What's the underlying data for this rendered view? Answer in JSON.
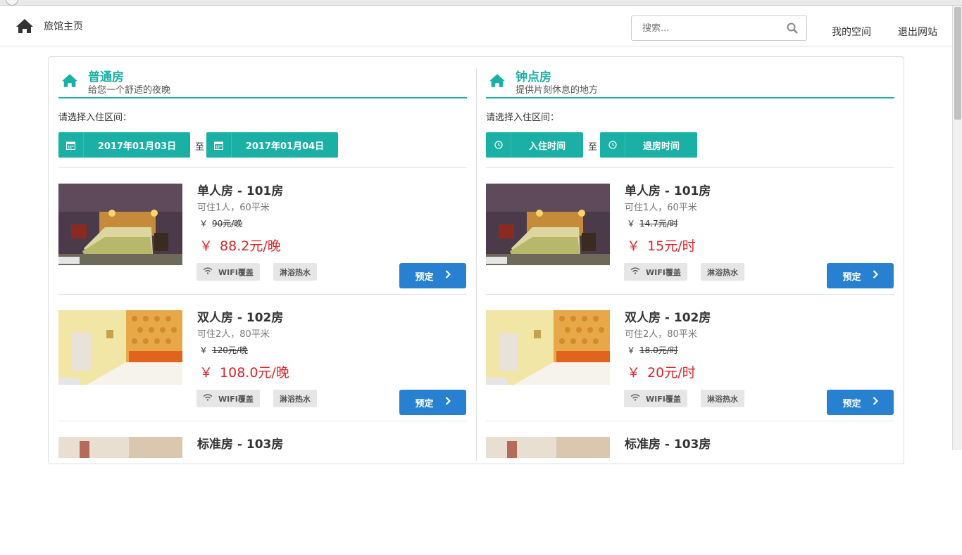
{
  "nav": {
    "home_icon": "home-icon",
    "title": "旅馆主页",
    "search_placeholder": "搜索...",
    "search_icon": "search-icon",
    "my_space": "我的空间",
    "logout": "退出网站"
  },
  "sections": [
    {
      "title": "普通房",
      "subtitle": "给您一个舒适的夜晚",
      "pick_label": "请选择入住区间：",
      "start": "2017年01月03日",
      "to": "至",
      "end": "2017年01月04日",
      "picker_icon": "calendar-icon",
      "rooms": [
        {
          "name": "单人房 - 101房",
          "capacity": "可住1人，60平米",
          "currency": "￥",
          "old_price": "90元/晚",
          "price": "88.2元/晚",
          "tags": [
            "WIFI覆盖",
            "淋浴热水"
          ],
          "book": "预定"
        },
        {
          "name": "双人房 - 102房",
          "capacity": "可住2人，80平米",
          "currency": "￥",
          "old_price": "120元/晚",
          "price": "108.0元/晚",
          "tags": [
            "WIFI覆盖",
            "淋浴热水"
          ],
          "book": "预定"
        },
        {
          "name": "标准房 - 103房"
        }
      ]
    },
    {
      "title": "钟点房",
      "subtitle": "提供片刻休息的地方",
      "pick_label": "请选择入住区间：",
      "start": "入住时间",
      "to": "至",
      "end": "退房时间",
      "picker_icon": "clock-icon",
      "rooms": [
        {
          "name": "单人房 - 101房",
          "capacity": "可住1人，60平米",
          "currency": "￥",
          "old_price": "14.7元/时",
          "price": "15元/时",
          "tags": [
            "WIFI覆盖",
            "淋浴热水"
          ],
          "book": "预定"
        },
        {
          "name": "双人房 - 102房",
          "capacity": "可住2人，80平米",
          "currency": "￥",
          "old_price": "18.0元/时",
          "price": "20元/时",
          "tags": [
            "WIFI覆盖",
            "淋浴热水"
          ],
          "book": "预定"
        },
        {
          "name": "标准房 - 103房"
        }
      ]
    }
  ],
  "colors": {
    "accent": "#1ab0a6",
    "price": "#d9262b",
    "book_button": "#2780d0"
  }
}
